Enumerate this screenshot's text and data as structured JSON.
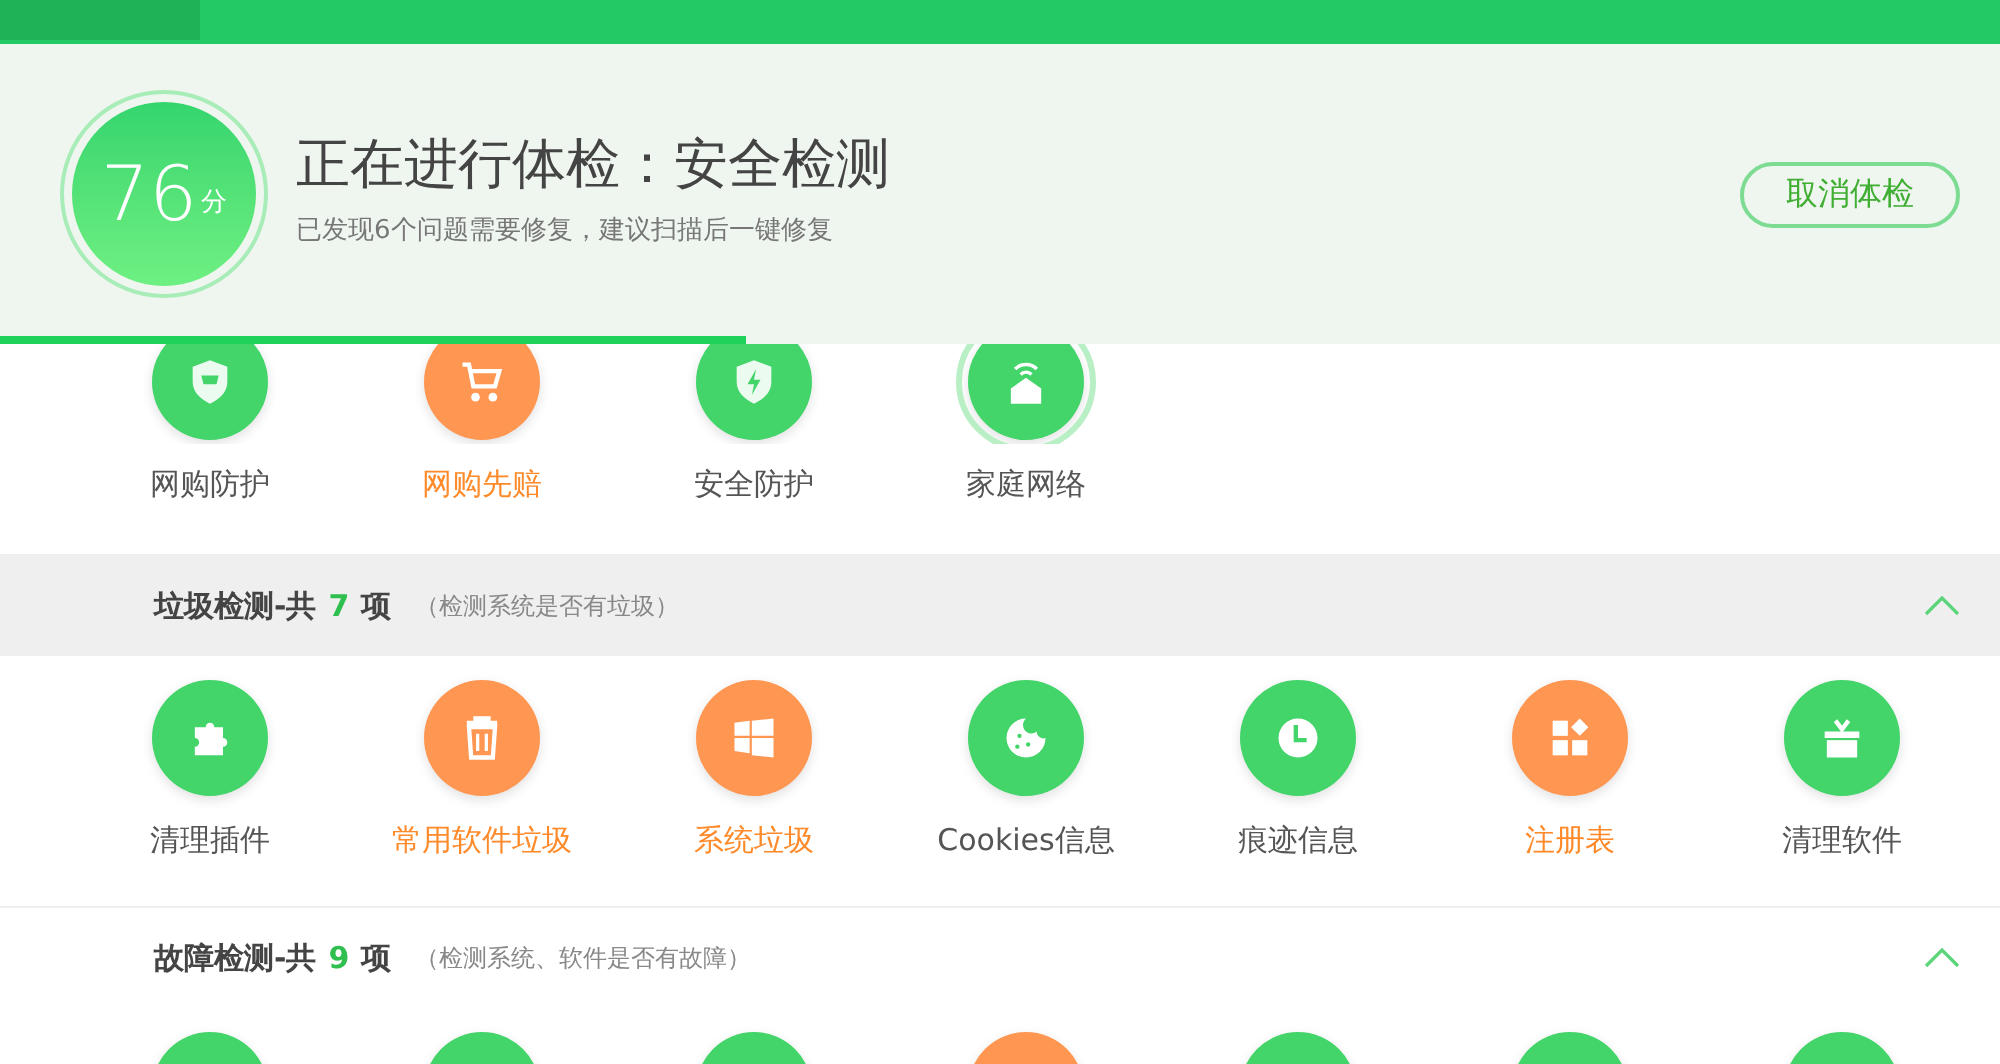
{
  "header": {
    "score": "76",
    "score_unit": "分",
    "title": "正在进行体检：安全检测",
    "subtitle": "已发现6个问题需要修复，建议扫描后一键修复",
    "cancel_button": "取消体检",
    "progress": {
      "level": 0.373
    }
  },
  "top_items": [
    {
      "kind": "shield-cart",
      "label": "网购防护",
      "warning": false,
      "scanning": false
    },
    {
      "kind": "cart",
      "label": "网购先赔",
      "warning": true,
      "scanning": false
    },
    {
      "kind": "shield-bolt",
      "label": "安全防护",
      "warning": false,
      "scanning": false
    },
    {
      "kind": "house-wifi",
      "label": "家庭网络",
      "warning": false,
      "scanning": true
    }
  ],
  "sections": [
    {
      "title": "垃圾检测-共",
      "count": "7",
      "unit": "项",
      "note": "（检测系统是否有垃圾）",
      "expanded": true,
      "shaded": true,
      "items": [
        {
          "kind": "puzzle",
          "label": "清理插件",
          "warning": false
        },
        {
          "kind": "trash",
          "label": "常用软件垃圾",
          "warning": true
        },
        {
          "kind": "windows",
          "label": "系统垃圾",
          "warning": true
        },
        {
          "kind": "cookie",
          "label": "Cookies信息",
          "warning": false
        },
        {
          "kind": "clock",
          "label": "痕迹信息",
          "warning": false
        },
        {
          "kind": "grid",
          "label": "注册表",
          "warning": true
        },
        {
          "kind": "box",
          "label": "清理软件",
          "warning": false
        }
      ]
    },
    {
      "title": "故障检测-共",
      "count": "9",
      "unit": "项",
      "note": "（检测系统、软件是否有故障）",
      "expanded": true,
      "shaded": false,
      "items": [
        {
          "warning": false
        },
        {
          "warning": false
        },
        {
          "warning": false
        },
        {
          "warning": true
        },
        {
          "warning": false
        },
        {
          "warning": false
        },
        {
          "warning": false
        }
      ]
    }
  ]
}
